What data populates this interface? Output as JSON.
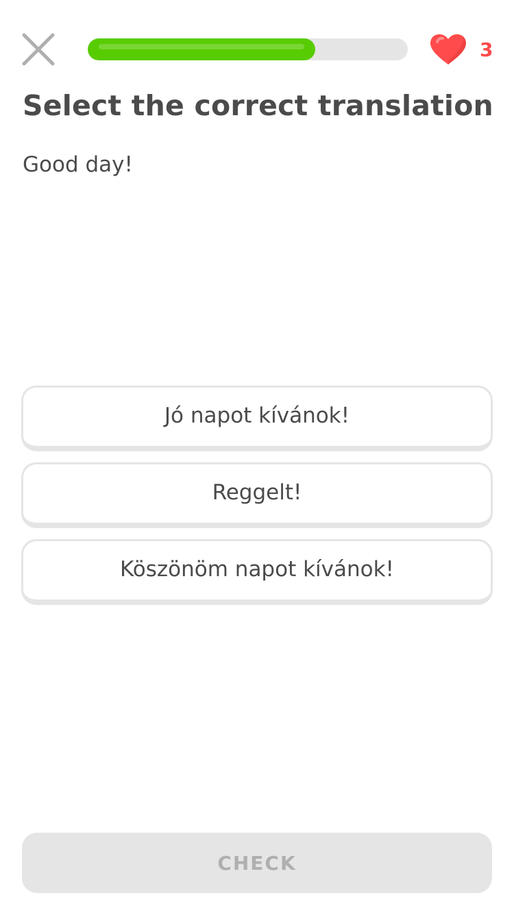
{
  "header": {
    "close_icon": "close-icon",
    "progress": 0.71,
    "progress_color": "#58cc02",
    "progress_track_color": "#e5e5e5",
    "hearts_icon": "heart-icon",
    "hearts_count": "3",
    "hearts_color": "#ff4b4b"
  },
  "question": {
    "title": "Select the correct translation",
    "prompt": "Good day!"
  },
  "choices": [
    {
      "label": "Jó napot kívánok!"
    },
    {
      "label": "Reggelt!"
    },
    {
      "label": "Köszönöm napot kívánok!"
    }
  ],
  "footer": {
    "check_label": "CHECK",
    "check_enabled": false
  }
}
